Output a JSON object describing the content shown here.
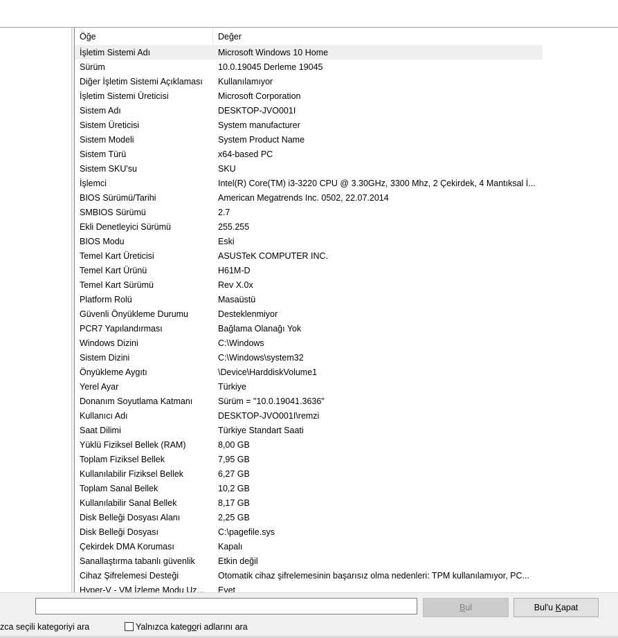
{
  "list": {
    "columns": {
      "item": "Öğe",
      "value": "Değer"
    },
    "rows": [
      {
        "item": "İşletim Sistemi Adı",
        "value": "Microsoft Windows 10 Home"
      },
      {
        "item": "Sürüm",
        "value": "10.0.19045 Derleme 19045"
      },
      {
        "item": "Diğer İşletim Sistemi Açıklaması",
        "value": "Kullanılamıyor"
      },
      {
        "item": "İşletim Sistemi Üreticisi",
        "value": "Microsoft Corporation"
      },
      {
        "item": "Sistem Adı",
        "value": "DESKTOP-JVO001I"
      },
      {
        "item": "Sistem Üreticisi",
        "value": "System manufacturer"
      },
      {
        "item": "Sistem Modeli",
        "value": "System Product Name"
      },
      {
        "item": "Sistem Türü",
        "value": "x64-based PC"
      },
      {
        "item": "Sistem SKU'su",
        "value": "SKU"
      },
      {
        "item": "İşlemci",
        "value": "Intel(R) Core(TM) i3-3220 CPU @ 3.30GHz, 3300 Mhz, 2 Çekirdek, 4 Mantıksal İ..."
      },
      {
        "item": "BIOS Sürümü/Tarihi",
        "value": "American Megatrends Inc. 0502, 22.07.2014"
      },
      {
        "item": "SMBIOS Sürümü",
        "value": "2.7"
      },
      {
        "item": "Ekli Denetleyici Sürümü",
        "value": "255.255"
      },
      {
        "item": "BIOS Modu",
        "value": "Eski"
      },
      {
        "item": "Temel Kart Üreticisi",
        "value": "ASUSTeK COMPUTER INC."
      },
      {
        "item": "Temel Kart Ürünü",
        "value": "H61M-D"
      },
      {
        "item": "Temel Kart Sürümü",
        "value": "Rev X.0x"
      },
      {
        "item": "Platform Rolü",
        "value": "Masaüstü"
      },
      {
        "item": "Güvenli Önyükleme Durumu",
        "value": "Desteklenmiyor"
      },
      {
        "item": "PCR7 Yapılandırması",
        "value": "Bağlama Olanağı Yok"
      },
      {
        "item": "Windows Dizini",
        "value": "C:\\Windows"
      },
      {
        "item": "Sistem Dizini",
        "value": "C:\\Windows\\system32"
      },
      {
        "item": "Önyükleme Aygıtı",
        "value": "\\Device\\HarddiskVolume1"
      },
      {
        "item": "Yerel Ayar",
        "value": "Türkiye"
      },
      {
        "item": "Donanım Soyutlama Katmanı",
        "value": "Sürüm = \"10.0.19041.3636\""
      },
      {
        "item": "Kullanıcı Adı",
        "value": "DESKTOP-JVO001I\\remzi"
      },
      {
        "item": "Saat Dilimi",
        "value": "Türkiye Standart Saati"
      },
      {
        "item": "Yüklü Fiziksel Bellek (RAM)",
        "value": "8,00 GB"
      },
      {
        "item": "Toplam Fiziksel Bellek",
        "value": "7,95 GB"
      },
      {
        "item": "Kullanılabilir Fiziksel Bellek",
        "value": "6,27 GB"
      },
      {
        "item": "Toplam Sanal Bellek",
        "value": "10,2 GB"
      },
      {
        "item": "Kullanılabilir Sanal Bellek",
        "value": "8,17 GB"
      },
      {
        "item": "Disk Belleği Dosyası Alanı",
        "value": "2,25 GB"
      },
      {
        "item": "Disk Belleği Dosyası",
        "value": "C:\\pagefile.sys"
      },
      {
        "item": "Çekirdek DMA Koruması",
        "value": "Kapalı"
      },
      {
        "item": "Sanallaştırma tabanlı güvenlik",
        "value": "Etkin değil"
      },
      {
        "item": "Cihaz Şifrelemesi Desteği",
        "value": "Otomatik cihaz şifrelemesinin başarısız olma nedenleri: TPM kullanılamıyor, PC..."
      },
      {
        "item": "Hyper-V - VM İzleme Modu Uz...",
        "value": "Evet"
      }
    ]
  },
  "find": {
    "input_value": "",
    "find_button": {
      "before": "",
      "accel": "B",
      "after": "ul"
    },
    "close_button": {
      "before": "Bul'u ",
      "accel": "K",
      "after": "apat"
    },
    "check_selected": "zca seçili kategoriyi ara",
    "check_names": {
      "before": "Yalnızca kateg",
      "accel": "o",
      "after": "ri adlarını ara"
    }
  }
}
